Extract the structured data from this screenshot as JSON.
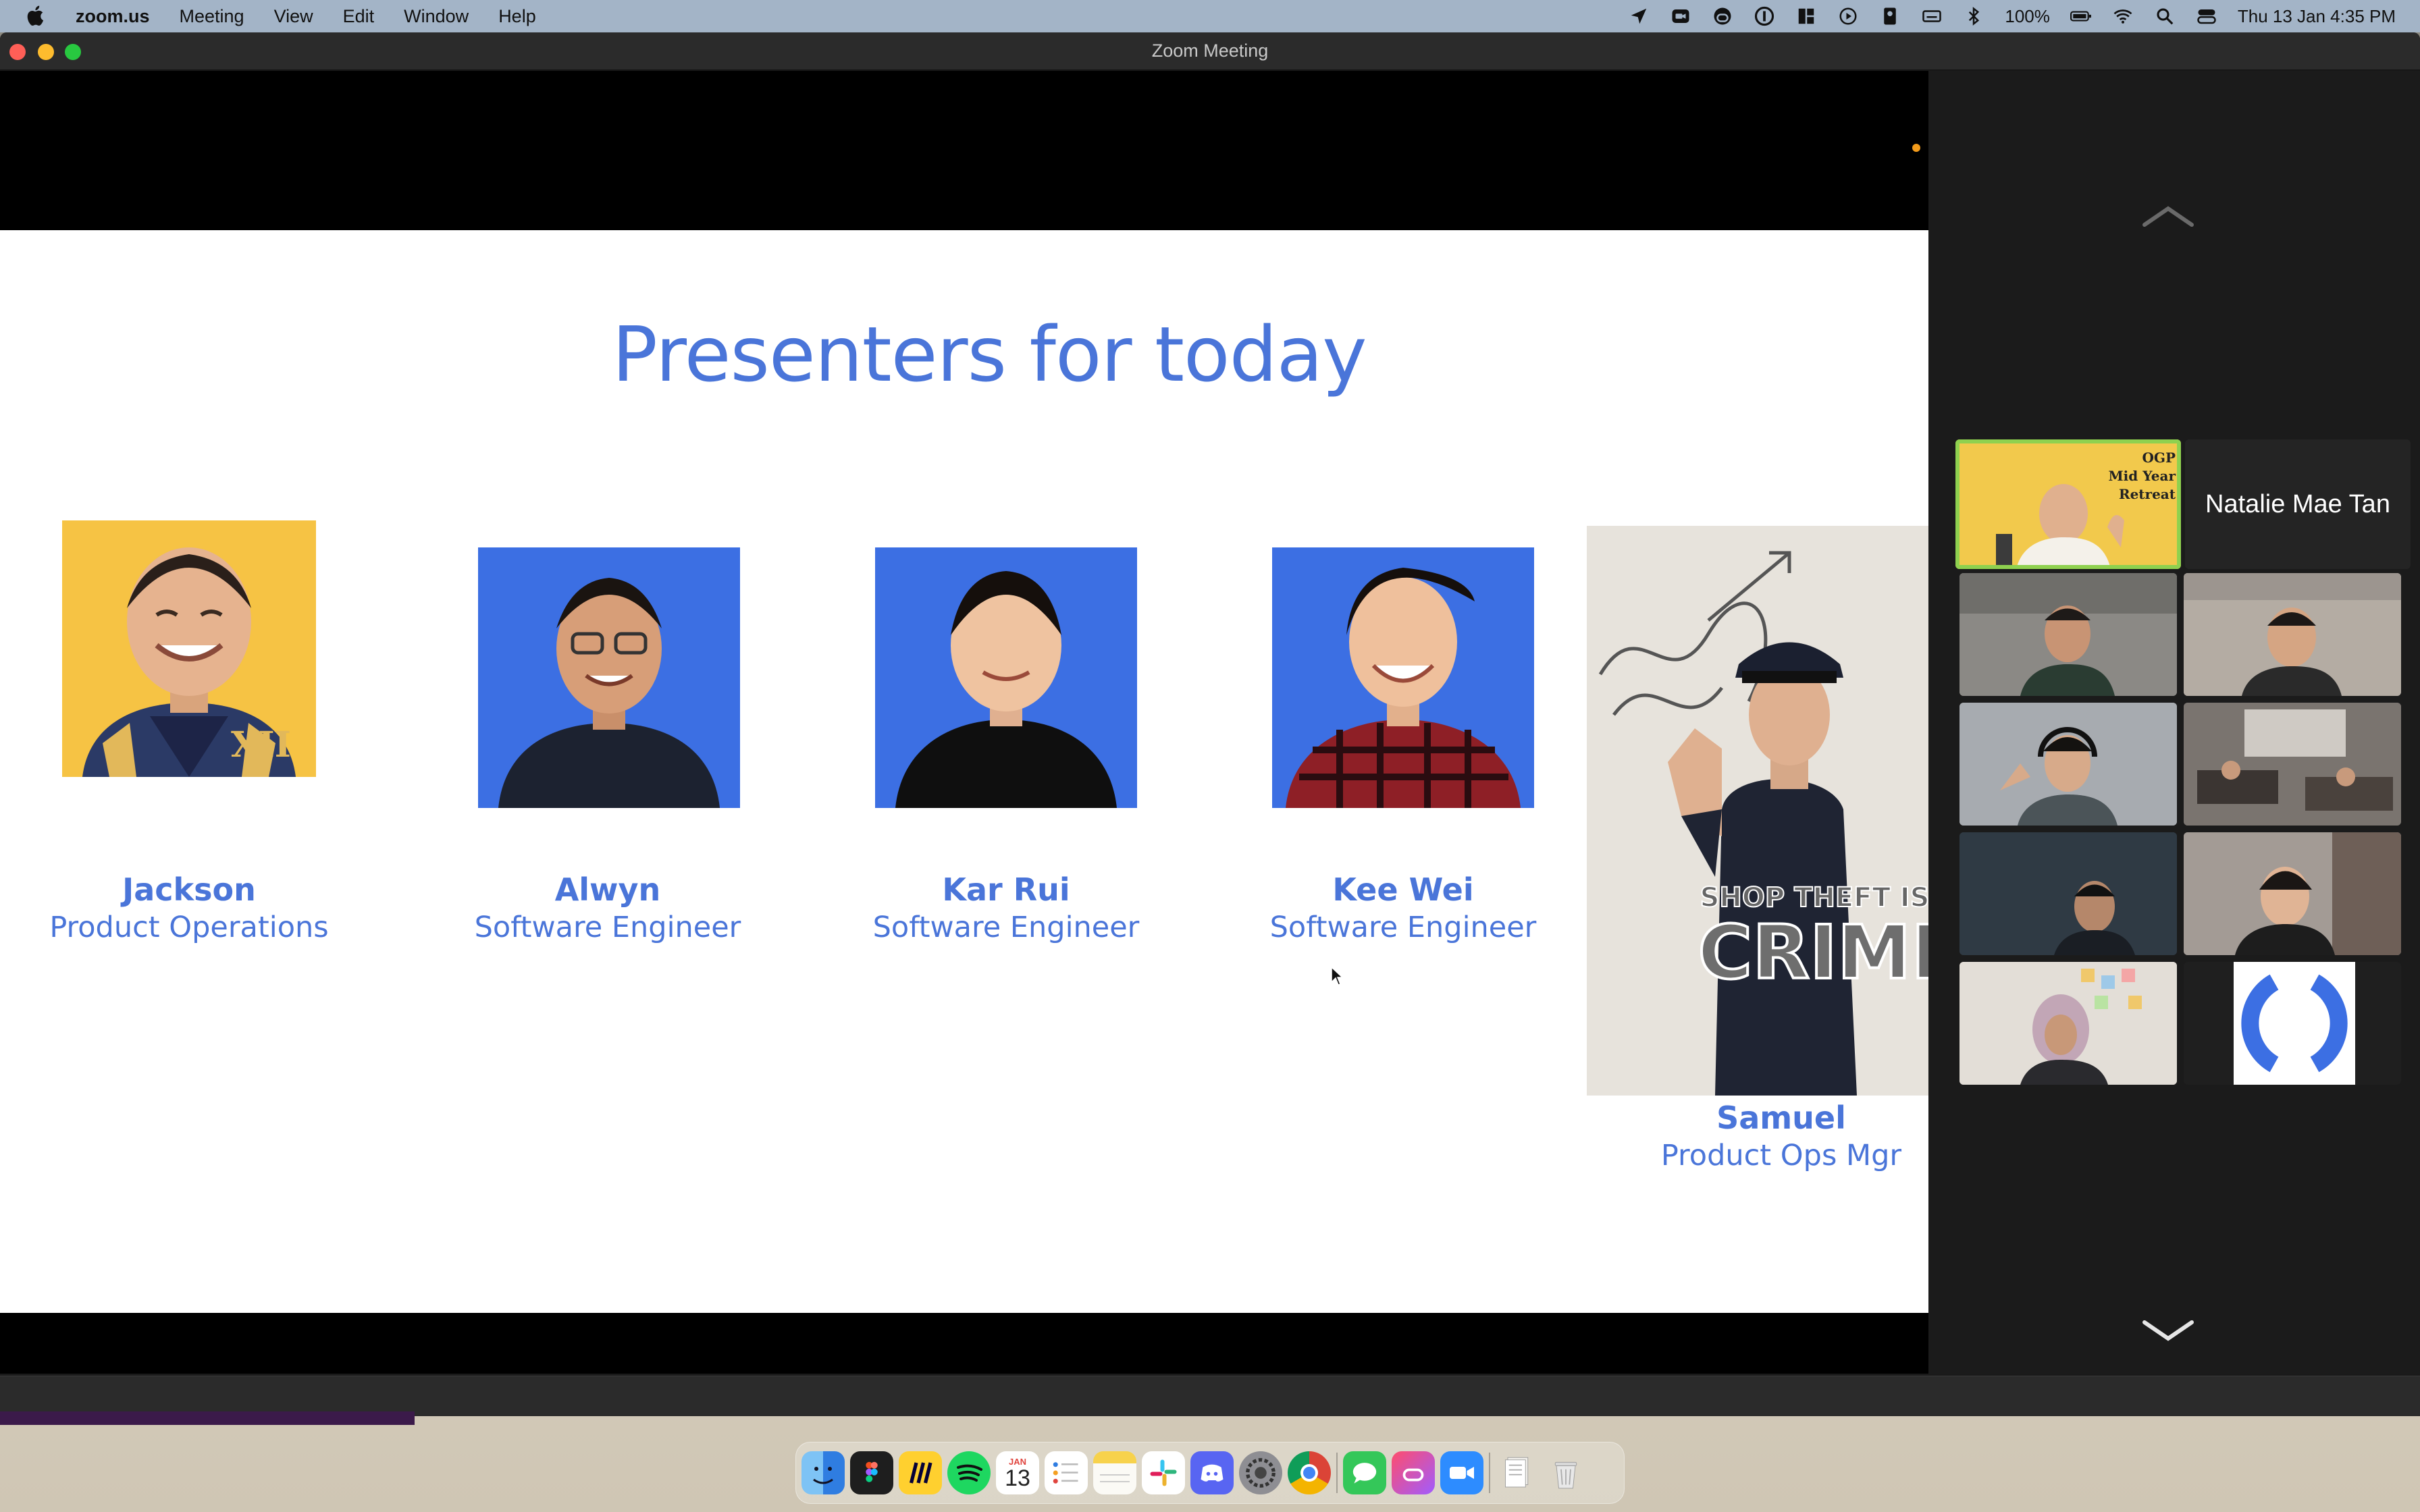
{
  "menubar": {
    "apple_icon": "apple-icon",
    "app_name": "zoom.us",
    "menus": [
      "Meeting",
      "View",
      "Edit",
      "Window",
      "Help"
    ],
    "battery": "100%",
    "datetime": "Thu 13 Jan  4:35 PM"
  },
  "window": {
    "title": "Zoom Meeting"
  },
  "slide": {
    "title": "Presenters for today",
    "presenters": [
      {
        "name": "Jackson",
        "role": "Product Operations"
      },
      {
        "name": "Alwyn",
        "role": "Software Engineer"
      },
      {
        "name": "Kar Rui",
        "role": "Software Engineer"
      },
      {
        "name": "Kee Wei",
        "role": "Software Engineer"
      },
      {
        "name": "Samuel",
        "role": "Product Ops Mgr"
      }
    ],
    "poster_text_1": "SHOP THEFT IS A",
    "poster_text_2": "CRIME"
  },
  "gallery": {
    "active_tile_text": [
      "OGP",
      "Mid Year",
      "Retreat"
    ],
    "name_tile": "Natalie Mae Tan",
    "participant_count": 10
  },
  "dock": {
    "calendar_month": "JAN",
    "calendar_day": "13"
  },
  "colors": {
    "slide_accent": "#4a75d9",
    "active_speaker": "#8fd14f",
    "menubar": "#a3b4c7"
  }
}
